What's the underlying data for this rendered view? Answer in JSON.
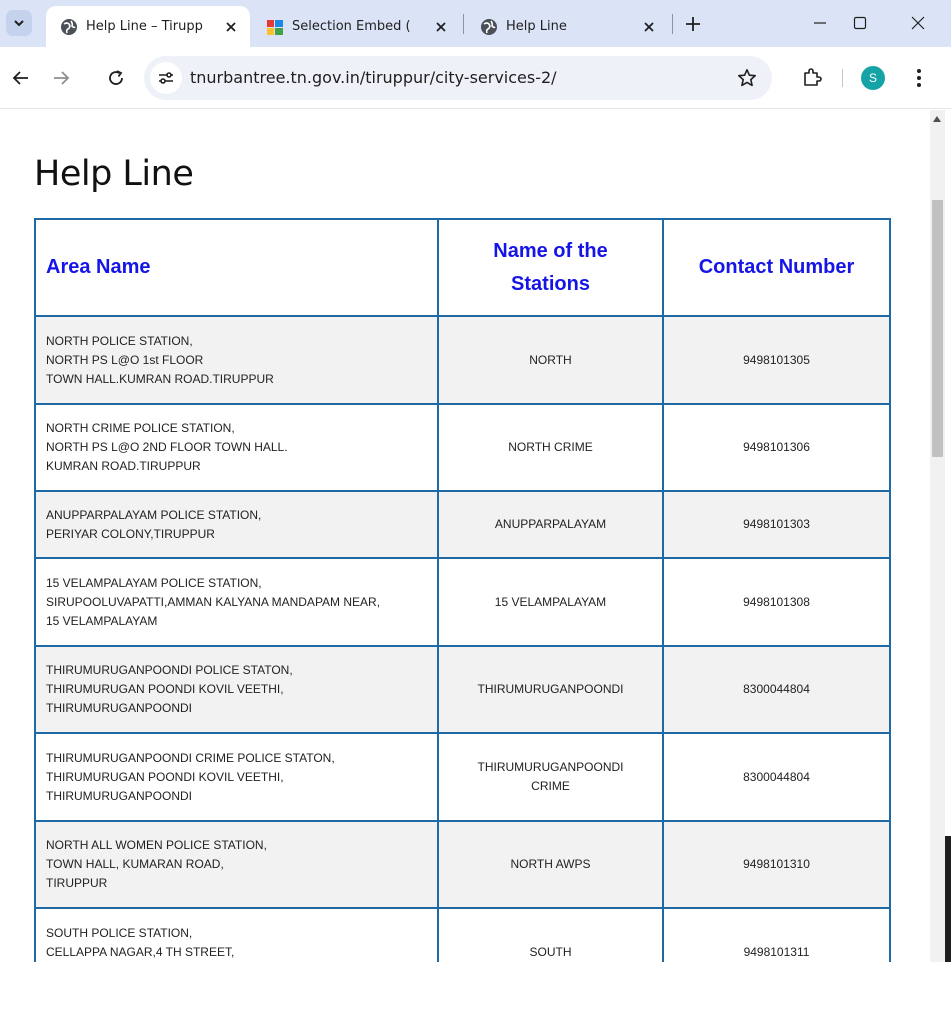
{
  "browser": {
    "tabs": [
      {
        "title": "Help Line – Tirupp",
        "icon": "globe-icon",
        "active": true
      },
      {
        "title": "Selection Embed (",
        "icon": "app-icon",
        "active": false
      },
      {
        "title": "Help Line",
        "icon": "globe-icon",
        "active": false
      }
    ],
    "url": "tnurbantree.tn.gov.in/tiruppur/city-services-2/",
    "profile_initial": "S",
    "profile_color": "#16a3a6"
  },
  "page": {
    "title": "Help Line",
    "table": {
      "headers": {
        "area": "Area Name",
        "station_line1": "Name of the",
        "station_line2": "Stations",
        "contact": "Contact Number"
      },
      "rows": [
        {
          "address": [
            "NORTH  POLICE STATION,",
            "NORTH PS L@O  1st FLOOR",
            "TOWN HALL.KUMRAN ROAD.TIRUPPUR"
          ],
          "station": [
            "NORTH"
          ],
          "contact": "9498101305"
        },
        {
          "address": [
            "NORTH CRIME POLICE STATION,",
            "NORTH PS L@O  2ND FLOOR TOWN HALL.",
            "KUMRAN ROAD.TIRUPPUR"
          ],
          "station": [
            "NORTH CRIME"
          ],
          "contact": "9498101306"
        },
        {
          "address": [
            "ANUPPARPALAYAM POLICE STATION,",
            "PERIYAR COLONY,TIRUPPUR"
          ],
          "station": [
            "ANUPPARPALAYAM"
          ],
          "contact": "9498101303"
        },
        {
          "address": [
            "15 VELAMPALAYAM POLICE STATION,",
            "SIRUPOOLUVAPATTI,AMMAN KALYANA MANDAPAM NEAR,",
            "15 VELAMPALAYAM"
          ],
          "station": [
            "15 VELAMPALAYAM"
          ],
          "contact": "9498101308"
        },
        {
          "address": [
            "THIRUMURUGANPOONDI POLICE STATON,",
            "THIRUMURUGAN POONDI KOVIL VEETHI,",
            "THIRUMURUGANPOONDI"
          ],
          "station": [
            "THIRUMURUGANPOONDI"
          ],
          "contact": "8300044804"
        },
        {
          "address": [
            "THIRUMURUGANPOONDI CRIME  POLICE STATON,",
            "THIRUMURUGAN POONDI KOVIL VEETHI,",
            "THIRUMURUGANPOONDI"
          ],
          "station": [
            "THIRUMURUGANPOONDI",
            "CRIME"
          ],
          "contact": "8300044804"
        },
        {
          "address": [
            "NORTH  ALL WOMEN POLICE STATION,",
            "TOWN HALL, KUMARAN ROAD,",
            "TIRUPPUR"
          ],
          "station": [
            "NORTH  AWPS"
          ],
          "contact": "9498101310"
        },
        {
          "address": [
            "SOUTH POLICE STATION,",
            "CELLAPPA NAGAR,4 TH STREET,",
            ""
          ],
          "station": [
            "SOUTH"
          ],
          "contact": "9498101311"
        }
      ]
    }
  }
}
